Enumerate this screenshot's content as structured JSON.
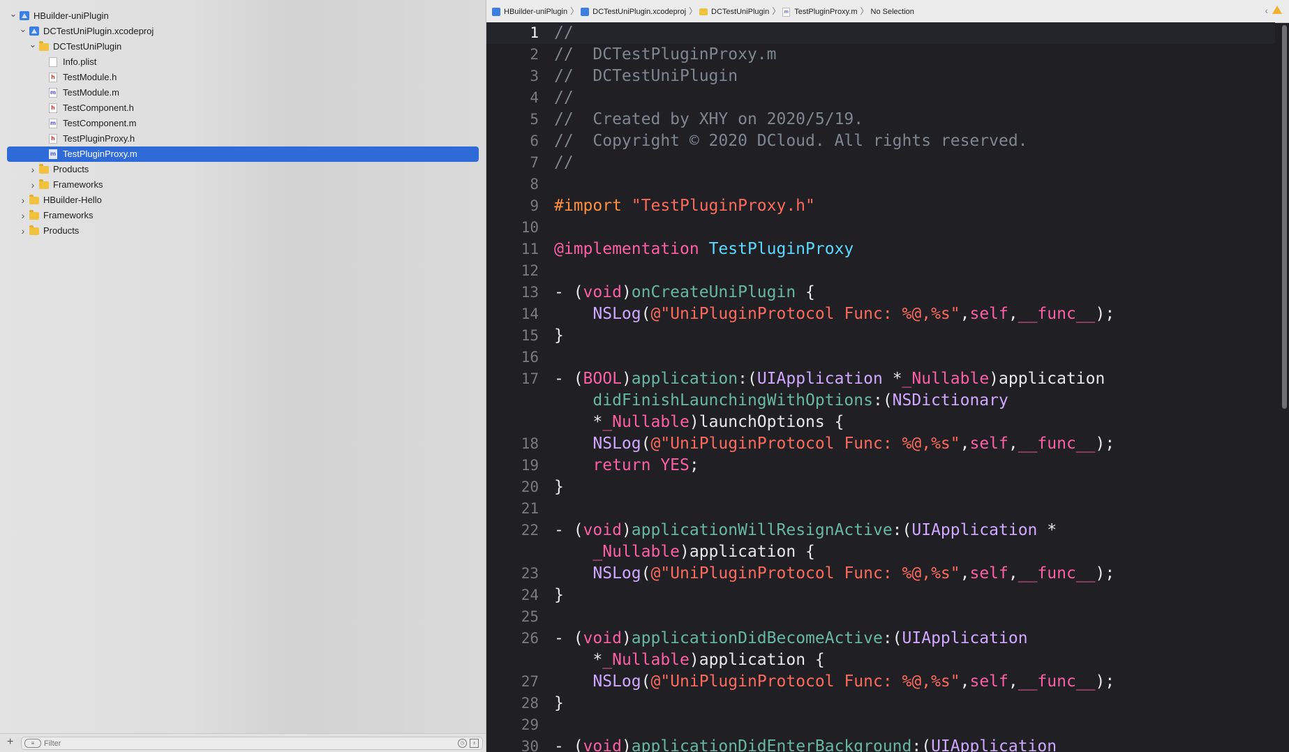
{
  "navigator": {
    "items": [
      {
        "label": "HBuilder-uniPlugin",
        "icon": "project-icon",
        "disclosure": "expanded"
      },
      {
        "label": "DCTestUniPlugin.xcodeproj",
        "icon": "project-icon",
        "disclosure": "expanded"
      },
      {
        "label": "DCTestUniPlugin",
        "icon": "folder-icon",
        "disclosure": "expanded"
      },
      {
        "label": "Info.plist",
        "icon": "plist-file-icon",
        "disclosure": "none"
      },
      {
        "label": "TestModule.h",
        "icon": "header-file-icon",
        "disclosure": "none"
      },
      {
        "label": "TestModule.m",
        "icon": "objc-file-icon",
        "disclosure": "none"
      },
      {
        "label": "TestComponent.h",
        "icon": "header-file-icon",
        "disclosure": "none"
      },
      {
        "label": "TestComponent.m",
        "icon": "objc-file-icon",
        "disclosure": "none"
      },
      {
        "label": "TestPluginProxy.h",
        "icon": "header-file-icon",
        "disclosure": "none"
      },
      {
        "label": "TestPluginProxy.m",
        "icon": "objc-file-icon",
        "disclosure": "none",
        "selected": true
      },
      {
        "label": "Products",
        "icon": "folder-icon",
        "disclosure": "collapsed"
      },
      {
        "label": "Frameworks",
        "icon": "folder-icon",
        "disclosure": "collapsed"
      },
      {
        "label": "HBuilder-Hello",
        "icon": "folder-icon",
        "disclosure": "collapsed"
      },
      {
        "label": "Frameworks",
        "icon": "folder-icon",
        "disclosure": "collapsed"
      },
      {
        "label": "Products",
        "icon": "folder-icon",
        "disclosure": "collapsed"
      }
    ],
    "file_glyphs": {
      "h": "h",
      "m": "m"
    },
    "filter": {
      "placeholder": "Filter",
      "add_label": "+"
    }
  },
  "jumpbar": {
    "crumbs": [
      {
        "label": "HBuilder-uniPlugin",
        "icon": "project-icon"
      },
      {
        "label": "DCTestUniPlugin.xcodeproj",
        "icon": "project-icon"
      },
      {
        "label": "DCTestUniPlugin",
        "icon": "folder-icon"
      },
      {
        "label": "TestPluginProxy.m",
        "icon": "objc-file-icon"
      },
      {
        "label": "No Selection",
        "icon": null
      }
    ],
    "separator": "〉"
  },
  "editor": {
    "current_line": 1,
    "lines": [
      {
        "n": "1",
        "tokens": [
          [
            "k-comment",
            "//"
          ]
        ]
      },
      {
        "n": "2",
        "tokens": [
          [
            "k-comment",
            "//  DCTestPluginProxy.m"
          ]
        ]
      },
      {
        "n": "3",
        "tokens": [
          [
            "k-comment",
            "//  DCTestUniPlugin"
          ]
        ]
      },
      {
        "n": "4",
        "tokens": [
          [
            "k-comment",
            "//"
          ]
        ]
      },
      {
        "n": "5",
        "tokens": [
          [
            "k-comment",
            "//  Created by XHY on 2020/5/19."
          ]
        ]
      },
      {
        "n": "6",
        "tokens": [
          [
            "k-comment",
            "//  Copyright © 2020 DCloud. All rights reserved."
          ]
        ]
      },
      {
        "n": "7",
        "tokens": [
          [
            "k-comment",
            "//"
          ]
        ]
      },
      {
        "n": "8",
        "tokens": []
      },
      {
        "n": "9",
        "tokens": [
          [
            "k-pre",
            "#import "
          ],
          [
            "k-str",
            "\"TestPluginProxy.h\""
          ]
        ]
      },
      {
        "n": "10",
        "tokens": []
      },
      {
        "n": "11",
        "tokens": [
          [
            "k-kw",
            "@implementation "
          ],
          [
            "k-cls",
            "TestPluginProxy"
          ]
        ]
      },
      {
        "n": "12",
        "tokens": []
      },
      {
        "n": "13",
        "tokens": [
          [
            "k-plain",
            "- ("
          ],
          [
            "k-kw",
            "void"
          ],
          [
            "k-plain",
            ")"
          ],
          [
            "k-fn",
            "onCreateUniPlugin"
          ],
          [
            "k-plain",
            " {"
          ]
        ]
      },
      {
        "n": "14",
        "tokens": [
          [
            "k-plain",
            "    "
          ],
          [
            "k-type",
            "NSLog"
          ],
          [
            "k-plain",
            "("
          ],
          [
            "k-str",
            "@\"UniPluginProtocol Func: %@,%s\""
          ],
          [
            "k-plain",
            ","
          ],
          [
            "k-kw",
            "self"
          ],
          [
            "k-plain",
            ","
          ],
          [
            "k-kw",
            "__func__"
          ],
          [
            "k-plain",
            ");"
          ]
        ]
      },
      {
        "n": "15",
        "tokens": [
          [
            "k-plain",
            "}"
          ]
        ]
      },
      {
        "n": "16",
        "tokens": []
      },
      {
        "n": "17",
        "tokens": [
          [
            "k-plain",
            "- ("
          ],
          [
            "k-kw",
            "BOOL"
          ],
          [
            "k-plain",
            ")"
          ],
          [
            "k-fn",
            "application"
          ],
          [
            "k-plain",
            ":("
          ],
          [
            "k-type",
            "UIApplication"
          ],
          [
            "k-plain",
            " *"
          ],
          [
            "k-kw",
            "_Nullable"
          ],
          [
            "k-plain",
            ")application"
          ]
        ]
      },
      {
        "n": "",
        "tokens": [
          [
            "k-plain",
            "    "
          ],
          [
            "k-fn",
            "didFinishLaunchingWithOptions"
          ],
          [
            "k-plain",
            ":("
          ],
          [
            "k-type",
            "NSDictionary"
          ]
        ]
      },
      {
        "n": "",
        "tokens": [
          [
            "k-plain",
            "    *"
          ],
          [
            "k-kw",
            "_Nullable"
          ],
          [
            "k-plain",
            ")launchOptions {"
          ]
        ]
      },
      {
        "n": "18",
        "tokens": [
          [
            "k-plain",
            "    "
          ],
          [
            "k-type",
            "NSLog"
          ],
          [
            "k-plain",
            "("
          ],
          [
            "k-str",
            "@\"UniPluginProtocol Func: %@,%s\""
          ],
          [
            "k-plain",
            ","
          ],
          [
            "k-kw",
            "self"
          ],
          [
            "k-plain",
            ","
          ],
          [
            "k-kw",
            "__func__"
          ],
          [
            "k-plain",
            ");"
          ]
        ]
      },
      {
        "n": "19",
        "tokens": [
          [
            "k-plain",
            "    "
          ],
          [
            "k-kw",
            "return YES"
          ],
          [
            "k-plain",
            ";"
          ]
        ]
      },
      {
        "n": "20",
        "tokens": [
          [
            "k-plain",
            "}"
          ]
        ]
      },
      {
        "n": "21",
        "tokens": []
      },
      {
        "n": "22",
        "tokens": [
          [
            "k-plain",
            "- ("
          ],
          [
            "k-kw",
            "void"
          ],
          [
            "k-plain",
            ")"
          ],
          [
            "k-fn",
            "applicationWillResignActive"
          ],
          [
            "k-plain",
            ":("
          ],
          [
            "k-type",
            "UIApplication"
          ],
          [
            "k-plain",
            " *"
          ]
        ]
      },
      {
        "n": "",
        "tokens": [
          [
            "k-plain",
            "    "
          ],
          [
            "k-kw",
            "_Nullable"
          ],
          [
            "k-plain",
            ")application {"
          ]
        ]
      },
      {
        "n": "23",
        "tokens": [
          [
            "k-plain",
            "    "
          ],
          [
            "k-type",
            "NSLog"
          ],
          [
            "k-plain",
            "("
          ],
          [
            "k-str",
            "@\"UniPluginProtocol Func: %@,%s\""
          ],
          [
            "k-plain",
            ","
          ],
          [
            "k-kw",
            "self"
          ],
          [
            "k-plain",
            ","
          ],
          [
            "k-kw",
            "__func__"
          ],
          [
            "k-plain",
            ");"
          ]
        ]
      },
      {
        "n": "24",
        "tokens": [
          [
            "k-plain",
            "}"
          ]
        ]
      },
      {
        "n": "25",
        "tokens": []
      },
      {
        "n": "26",
        "tokens": [
          [
            "k-plain",
            "- ("
          ],
          [
            "k-kw",
            "void"
          ],
          [
            "k-plain",
            ")"
          ],
          [
            "k-fn",
            "applicationDidBecomeActive"
          ],
          [
            "k-plain",
            ":("
          ],
          [
            "k-type",
            "UIApplication"
          ]
        ]
      },
      {
        "n": "",
        "tokens": [
          [
            "k-plain",
            "    *"
          ],
          [
            "k-kw",
            "_Nullable"
          ],
          [
            "k-plain",
            ")application {"
          ]
        ]
      },
      {
        "n": "27",
        "tokens": [
          [
            "k-plain",
            "    "
          ],
          [
            "k-type",
            "NSLog"
          ],
          [
            "k-plain",
            "("
          ],
          [
            "k-str",
            "@\"UniPluginProtocol Func: %@,%s\""
          ],
          [
            "k-plain",
            ","
          ],
          [
            "k-kw",
            "self"
          ],
          [
            "k-plain",
            ","
          ],
          [
            "k-kw",
            "__func__"
          ],
          [
            "k-plain",
            ");"
          ]
        ]
      },
      {
        "n": "28",
        "tokens": [
          [
            "k-plain",
            "}"
          ]
        ]
      },
      {
        "n": "29",
        "tokens": []
      },
      {
        "n": "30",
        "tokens": [
          [
            "k-plain",
            "- ("
          ],
          [
            "k-kw",
            "void"
          ],
          [
            "k-plain",
            ")"
          ],
          [
            "k-fn",
            "applicationDidEnterBackground"
          ],
          [
            "k-plain",
            ":("
          ],
          [
            "k-type",
            "UIApplication"
          ]
        ]
      }
    ]
  },
  "colors": {
    "selection": "#2f6ad9",
    "editor_background": "#1f1f24",
    "comment": "#7e868f",
    "keyword": "#fc5fa3",
    "string": "#fc6a5d",
    "preprocessor": "#fd8f3f",
    "class_name": "#5dd8ff",
    "method_name": "#67b7a4",
    "type_name": "#d0a8ff"
  }
}
